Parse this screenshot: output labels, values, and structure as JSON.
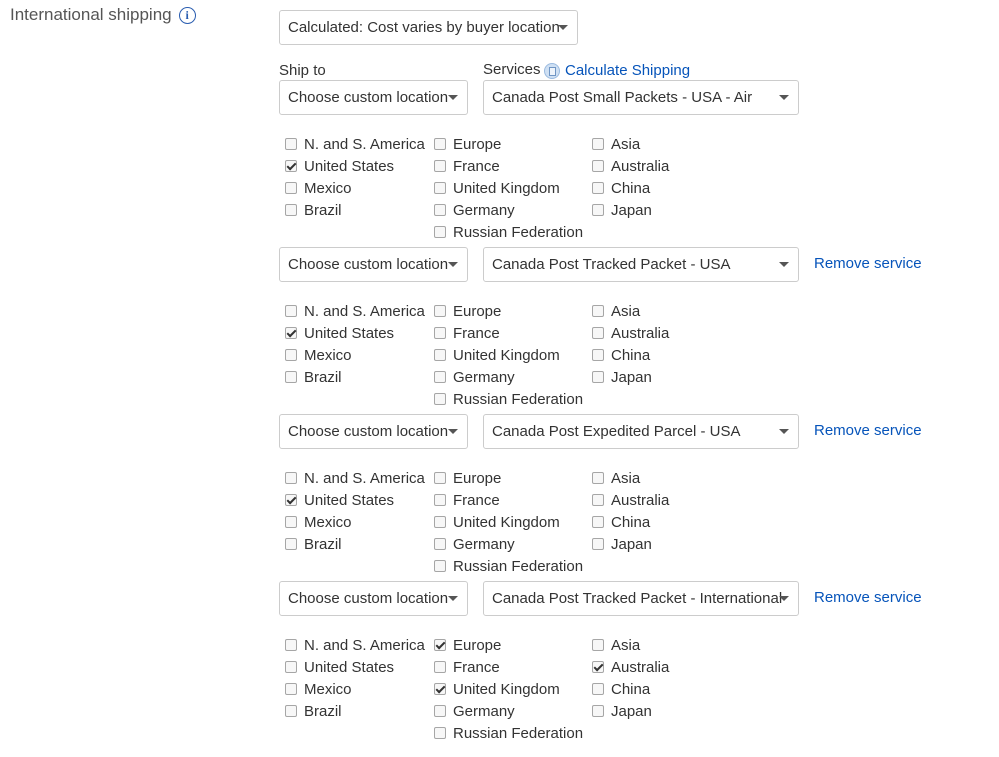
{
  "section": {
    "label": "International shipping",
    "info_icon": "info-icon",
    "cost_type": "Calculated: Cost varies by buyer location"
  },
  "headers": {
    "ship_to": "Ship to",
    "services": "Services",
    "calculate_shipping": "Calculate Shipping",
    "calculate_icon": "calculator-icon"
  },
  "services": [
    {
      "location": "Choose custom location",
      "service": "Canada Post Small Packets - USA - Air",
      "remove": "",
      "regions": [
        [
          {
            "label": "N. and S. America",
            "checked": false
          },
          {
            "label": "United States",
            "checked": true
          },
          {
            "label": "Mexico",
            "checked": false
          },
          {
            "label": "Brazil",
            "checked": false
          }
        ],
        [
          {
            "label": "Europe",
            "checked": false
          },
          {
            "label": "France",
            "checked": false
          },
          {
            "label": "United Kingdom",
            "checked": false
          },
          {
            "label": "Germany",
            "checked": false
          },
          {
            "label": "Russian Federation",
            "checked": false
          }
        ],
        [
          {
            "label": "Asia",
            "checked": false
          },
          {
            "label": "Australia",
            "checked": false
          },
          {
            "label": "China",
            "checked": false
          },
          {
            "label": "Japan",
            "checked": false
          }
        ]
      ]
    },
    {
      "location": "Choose custom location",
      "service": "Canada Post Tracked Packet - USA",
      "remove": "Remove service",
      "regions": [
        [
          {
            "label": "N. and S. America",
            "checked": false
          },
          {
            "label": "United States",
            "checked": true
          },
          {
            "label": "Mexico",
            "checked": false
          },
          {
            "label": "Brazil",
            "checked": false
          }
        ],
        [
          {
            "label": "Europe",
            "checked": false
          },
          {
            "label": "France",
            "checked": false
          },
          {
            "label": "United Kingdom",
            "checked": false
          },
          {
            "label": "Germany",
            "checked": false
          },
          {
            "label": "Russian Federation",
            "checked": false
          }
        ],
        [
          {
            "label": "Asia",
            "checked": false
          },
          {
            "label": "Australia",
            "checked": false
          },
          {
            "label": "China",
            "checked": false
          },
          {
            "label": "Japan",
            "checked": false
          }
        ]
      ]
    },
    {
      "location": "Choose custom location",
      "service": "Canada Post Expedited Parcel - USA",
      "remove": "Remove service",
      "regions": [
        [
          {
            "label": "N. and S. America",
            "checked": false
          },
          {
            "label": "United States",
            "checked": true
          },
          {
            "label": "Mexico",
            "checked": false
          },
          {
            "label": "Brazil",
            "checked": false
          }
        ],
        [
          {
            "label": "Europe",
            "checked": false
          },
          {
            "label": "France",
            "checked": false
          },
          {
            "label": "United Kingdom",
            "checked": false
          },
          {
            "label": "Germany",
            "checked": false
          },
          {
            "label": "Russian Federation",
            "checked": false
          }
        ],
        [
          {
            "label": "Asia",
            "checked": false
          },
          {
            "label": "Australia",
            "checked": false
          },
          {
            "label": "China",
            "checked": false
          },
          {
            "label": "Japan",
            "checked": false
          }
        ]
      ]
    },
    {
      "location": "Choose custom location",
      "service": "Canada Post Tracked Packet - International",
      "remove": "Remove service",
      "regions": [
        [
          {
            "label": "N. and S. America",
            "checked": false
          },
          {
            "label": "United States",
            "checked": false
          },
          {
            "label": "Mexico",
            "checked": false
          },
          {
            "label": "Brazil",
            "checked": false
          }
        ],
        [
          {
            "label": "Europe",
            "checked": true
          },
          {
            "label": "France",
            "checked": false
          },
          {
            "label": "United Kingdom",
            "checked": true
          },
          {
            "label": "Germany",
            "checked": false
          },
          {
            "label": "Russian Federation",
            "checked": false
          }
        ],
        [
          {
            "label": "Asia",
            "checked": false
          },
          {
            "label": "Australia",
            "checked": true
          },
          {
            "label": "China",
            "checked": false
          },
          {
            "label": "Japan",
            "checked": false
          }
        ]
      ]
    }
  ]
}
